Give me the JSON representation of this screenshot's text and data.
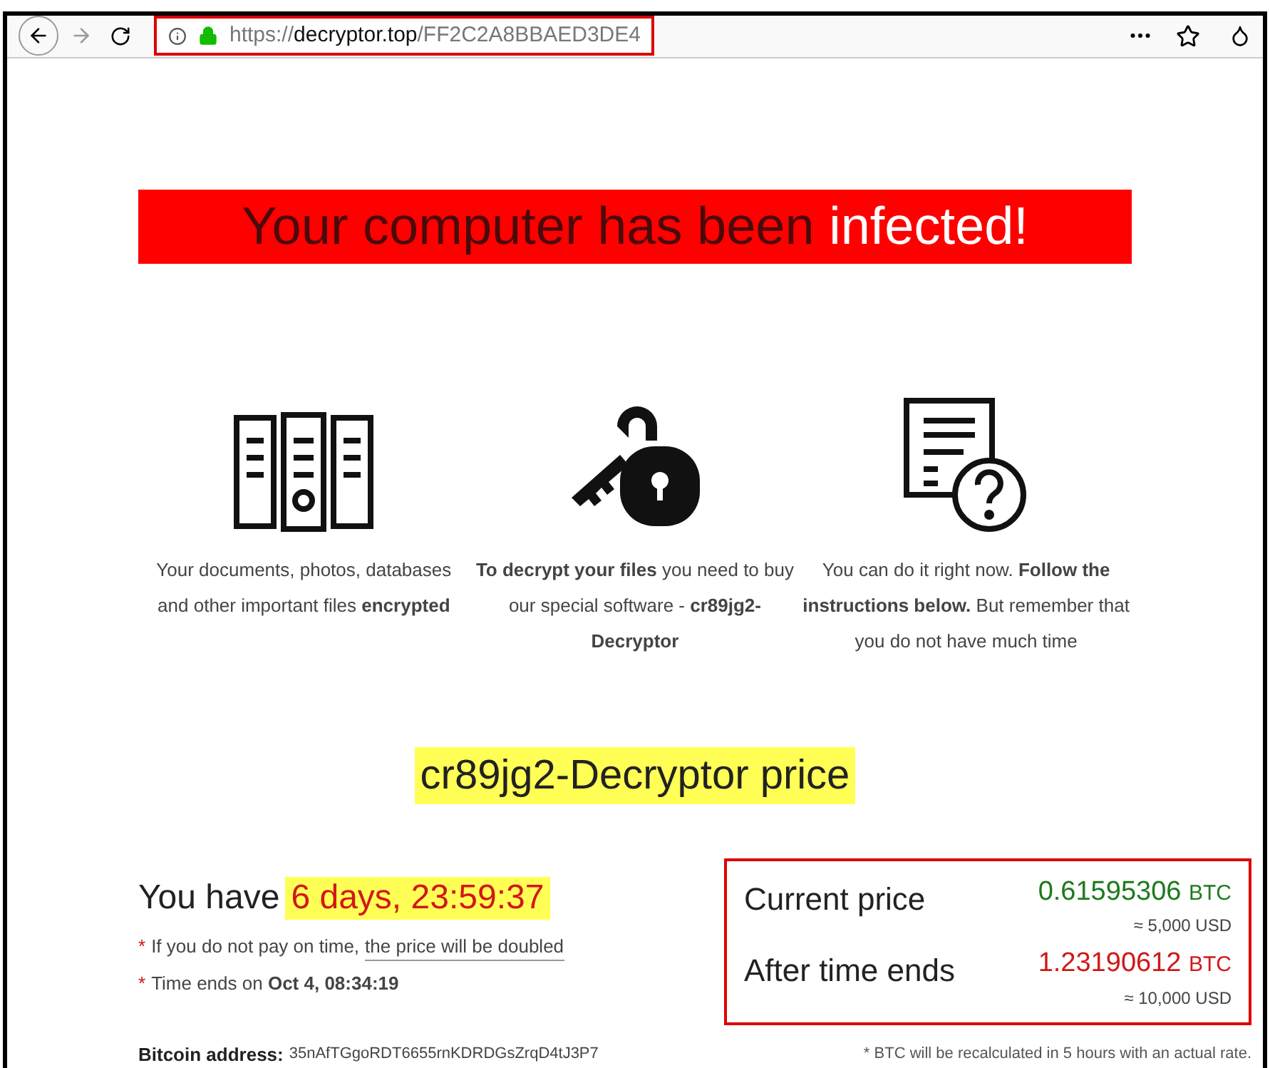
{
  "address_bar": {
    "scheme": "https://",
    "domain": "decryptor.top",
    "path": "/FF2C2A8BBAED3DE4"
  },
  "banner": {
    "text": "Your computer has been",
    "highlight": "infected!"
  },
  "features": [
    {
      "kind": "files",
      "text": "Your documents, photos, databases and other important files **encrypted**"
    },
    {
      "kind": "key-lock",
      "text": "**To decrypt your files** you need to buy our special software - **cr89jg2-Decryptor**"
    },
    {
      "kind": "document-question",
      "text": "You can do it right now. **Follow the instructions below.** But remember that you do not have much time"
    }
  ],
  "price_heading": "cr89jg2-Decryptor price",
  "timer": {
    "label": "You have",
    "value": "6 days, 23:59:37"
  },
  "notes": [
    {
      "mark": "*",
      "text": "If you do not pay on time,",
      "link": "the price will be doubled"
    },
    {
      "mark": "*",
      "text": "Time ends on **Oct 4, 08:34:19**"
    }
  ],
  "bitcoin": {
    "label": "Bitcoin address:",
    "value": "35nAfTGgoRDT6655rnKDRDGsZrqD4tJ3P7"
  },
  "prices": [
    {
      "label": "Current price",
      "amount": "0.61595306",
      "unit": "BTC",
      "usd": "≈ 5,000 USD",
      "color": "#1e7a1e"
    },
    {
      "label": "After time ends",
      "amount": "1.23190612",
      "unit": "BTC",
      "usd": "≈ 10,000 USD",
      "color": "#d01818"
    }
  ],
  "footnote": "* BTC will be recalculated in 5 hours with an actual rate."
}
